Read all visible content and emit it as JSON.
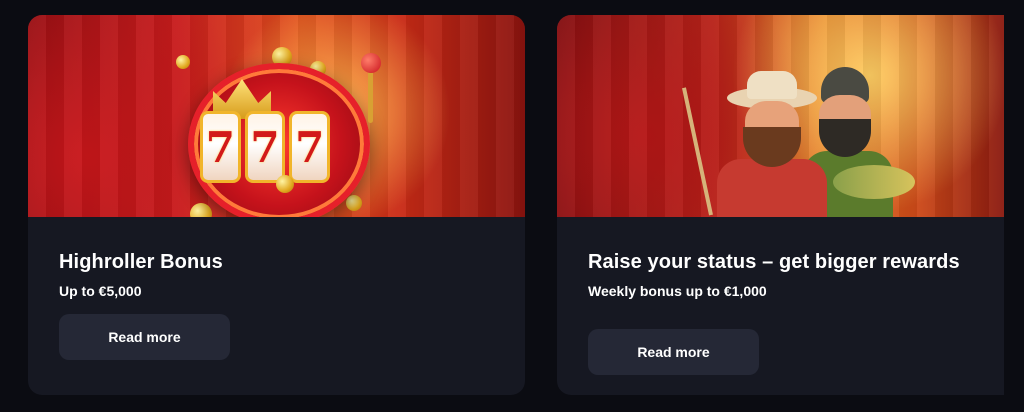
{
  "cards": [
    {
      "title": "Highroller Bonus",
      "subtitle": "Up to €5,000",
      "button_label": "Read more",
      "reel_symbols": [
        "7",
        "7",
        "7"
      ]
    },
    {
      "title": "Raise your status – get bigger rewards",
      "subtitle": "Weekly bonus up to €1,000",
      "button_label": "Read more"
    }
  ],
  "colors": {
    "page_background": "#0b0c12",
    "card_background": "#161822",
    "button_background": "#252836",
    "text": "#ffffff"
  }
}
